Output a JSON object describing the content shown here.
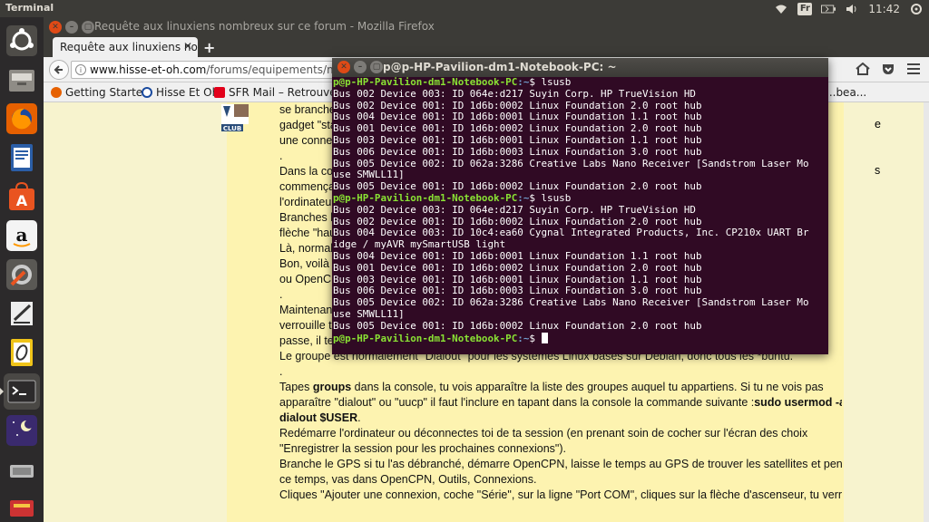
{
  "top_panel": {
    "title": "Terminal",
    "keyboard": "Fr",
    "clock": "11:42"
  },
  "launcher": {
    "items": [
      {
        "name": "ubuntu-dash-icon"
      },
      {
        "name": "files-icon"
      },
      {
        "name": "firefox-icon"
      },
      {
        "name": "libreoffice-writer-icon"
      },
      {
        "name": "software-center-icon"
      },
      {
        "name": "amazon-icon"
      },
      {
        "name": "system-settings-icon"
      },
      {
        "name": "text-editor-icon"
      },
      {
        "name": "draw-icon"
      },
      {
        "name": "terminal-icon"
      },
      {
        "name": "night-sky-icon"
      },
      {
        "name": "usb-drive-icon"
      },
      {
        "name": "tools-icon"
      }
    ]
  },
  "firefox": {
    "window_title": "Requête aux linuxiens nombreux sur ce forum - Mozilla Firefox",
    "tab_label": "Requête aux linuxiens nom",
    "tab_close": "✕",
    "new_tab": "+",
    "url_domain": "www.hisse-et-oh.com",
    "url_path": "/forums/equipements/messag",
    "bookmarks": [
      "Getting Started",
      "Hisse Et Oh",
      "SFR Mail – Retrouvez",
      "...bea..."
    ],
    "post_lines": [
      {
        "pre": "se branche",
        "bold": "",
        "post": ""
      },
      {
        "pre": "gadget \"sta",
        "bold": "",
        "post": ""
      },
      {
        "pre": "une conne",
        "bold": "",
        "post": ""
      },
      {
        "pre": ".",
        "bold": "",
        "post": ""
      },
      {
        "pre": "Dans la co",
        "bold": "",
        "post": ""
      },
      {
        "pre": "commença",
        "bold": "",
        "post": ""
      },
      {
        "pre": "l'ordinateu",
        "bold": "",
        "post": ""
      },
      {
        "pre": "Branches l",
        "bold": "",
        "post": ""
      },
      {
        "pre": "flèche \"hau",
        "bold": "",
        "post": ""
      },
      {
        "pre": "Là, normal",
        "bold": "",
        "post": ""
      },
      {
        "pre": "Bon, voilà",
        "bold": "",
        "post": ""
      },
      {
        "pre": "ou OpenC",
        "bold": "",
        "post": ""
      },
      {
        "pre": ".",
        "bold": "",
        "post": ""
      },
      {
        "pre": "Maintenan",
        "bold": "",
        "post": ""
      },
      {
        "pre": "verrouille t",
        "bold": "",
        "post": ""
      },
      {
        "pre": "passe, il te",
        "bold": "",
        "post": ""
      },
      {
        "pre": "Le groupe est normalement \"Dialout\" pour les systèmes Linux basés sur Debian, donc tous les *buntu.",
        "bold": "",
        "post": ""
      },
      {
        "pre": ".",
        "bold": "",
        "post": ""
      },
      {
        "pre": "Tapes ",
        "bold": "groups",
        "post": " dans la console, tu vois apparaître la liste des groupes auquel tu appartiens. Si tu ne vois pas"
      },
      {
        "pre": "apparaître \"dialout\" ou \"uucp\" il faut l'inclure en tapant dans la console la commande suivante :",
        "bold": "sudo usermod -a -G",
        "post": ""
      },
      {
        "pre": "",
        "bold": "dialout $USER",
        "post": "."
      },
      {
        "pre": "Redémarre l'ordinateur ou déconnectes toi de ta session (en prenant soin de cocher sur l'écran des choix",
        "bold": "",
        "post": ""
      },
      {
        "pre": "\"Enregistrer la session pour les prochaines connexions\").",
        "bold": "",
        "post": ""
      },
      {
        "pre": "Branche le GPS si tu l'as débranché, démarre OpenCPN, laisse le temps au GPS de trouver les satellites et pendant",
        "bold": "",
        "post": ""
      },
      {
        "pre": "ce temps, vas dans OpenCPN, Outils, Connexions.",
        "bold": "",
        "post": ""
      },
      {
        "pre": "Cliques \"Ajouter une connexion, coche \"Série\", sur la ligne \"Port COM\", cliques sur la flèche d'ascenseur, tu verras",
        "bold": "",
        "post": ""
      }
    ],
    "right_clip_1": "e",
    "right_clip_2": "s"
  },
  "terminal": {
    "window_title": "p@p-HP-Pavilion-dm1-Notebook-PC: ~",
    "prompt": "p@p-HP-Pavilion-dm1-Notebook-PC",
    "path": ":~",
    "lines": [
      {
        "type": "prompt",
        "cmd": "$ lsusb"
      },
      {
        "type": "out",
        "text": "Bus 002 Device 003: ID 064e:d217 Suyin Corp. HP TrueVision HD"
      },
      {
        "type": "out",
        "text": "Bus 002 Device 001: ID 1d6b:0002 Linux Foundation 2.0 root hub"
      },
      {
        "type": "out",
        "text": "Bus 004 Device 001: ID 1d6b:0001 Linux Foundation 1.1 root hub"
      },
      {
        "type": "out",
        "text": "Bus 001 Device 001: ID 1d6b:0002 Linux Foundation 2.0 root hub"
      },
      {
        "type": "out",
        "text": "Bus 003 Device 001: ID 1d6b:0001 Linux Foundation 1.1 root hub"
      },
      {
        "type": "out",
        "text": "Bus 006 Device 001: ID 1d6b:0003 Linux Foundation 3.0 root hub"
      },
      {
        "type": "out",
        "text": "Bus 005 Device 002: ID 062a:3286 Creative Labs Nano Receiver [Sandstrom Laser Mo"
      },
      {
        "type": "out",
        "text": "use SMWLL11]"
      },
      {
        "type": "out",
        "text": "Bus 005 Device 001: ID 1d6b:0002 Linux Foundation 2.0 root hub"
      },
      {
        "type": "prompt",
        "cmd": "$ lsusb"
      },
      {
        "type": "out",
        "text": "Bus 002 Device 003: ID 064e:d217 Suyin Corp. HP TrueVision HD"
      },
      {
        "type": "out",
        "text": "Bus 002 Device 001: ID 1d6b:0002 Linux Foundation 2.0 root hub"
      },
      {
        "type": "out",
        "text": "Bus 004 Device 003: ID 10c4:ea60 Cygnal Integrated Products, Inc. CP210x UART Br"
      },
      {
        "type": "out",
        "text": "idge / myAVR mySmartUSB light"
      },
      {
        "type": "out",
        "text": "Bus 004 Device 001: ID 1d6b:0001 Linux Foundation 1.1 root hub"
      },
      {
        "type": "out",
        "text": "Bus 001 Device 001: ID 1d6b:0002 Linux Foundation 2.0 root hub"
      },
      {
        "type": "out",
        "text": "Bus 003 Device 001: ID 1d6b:0001 Linux Foundation 1.1 root hub"
      },
      {
        "type": "out",
        "text": "Bus 006 Device 001: ID 1d6b:0003 Linux Foundation 3.0 root hub"
      },
      {
        "type": "out",
        "text": "Bus 005 Device 002: ID 062a:3286 Creative Labs Nano Receiver [Sandstrom Laser Mo"
      },
      {
        "type": "out",
        "text": "use SMWLL11]"
      },
      {
        "type": "out",
        "text": "Bus 005 Device 001: ID 1d6b:0002 Linux Foundation 2.0 root hub"
      },
      {
        "type": "prompt",
        "cmd": "$ "
      }
    ]
  },
  "colors": {
    "terminal_bg": "#300a24",
    "prompt_green": "#8ae234",
    "path_blue": "#729fcf",
    "panel_bg": "#3c3b37",
    "close_orange": "#df4a16"
  }
}
